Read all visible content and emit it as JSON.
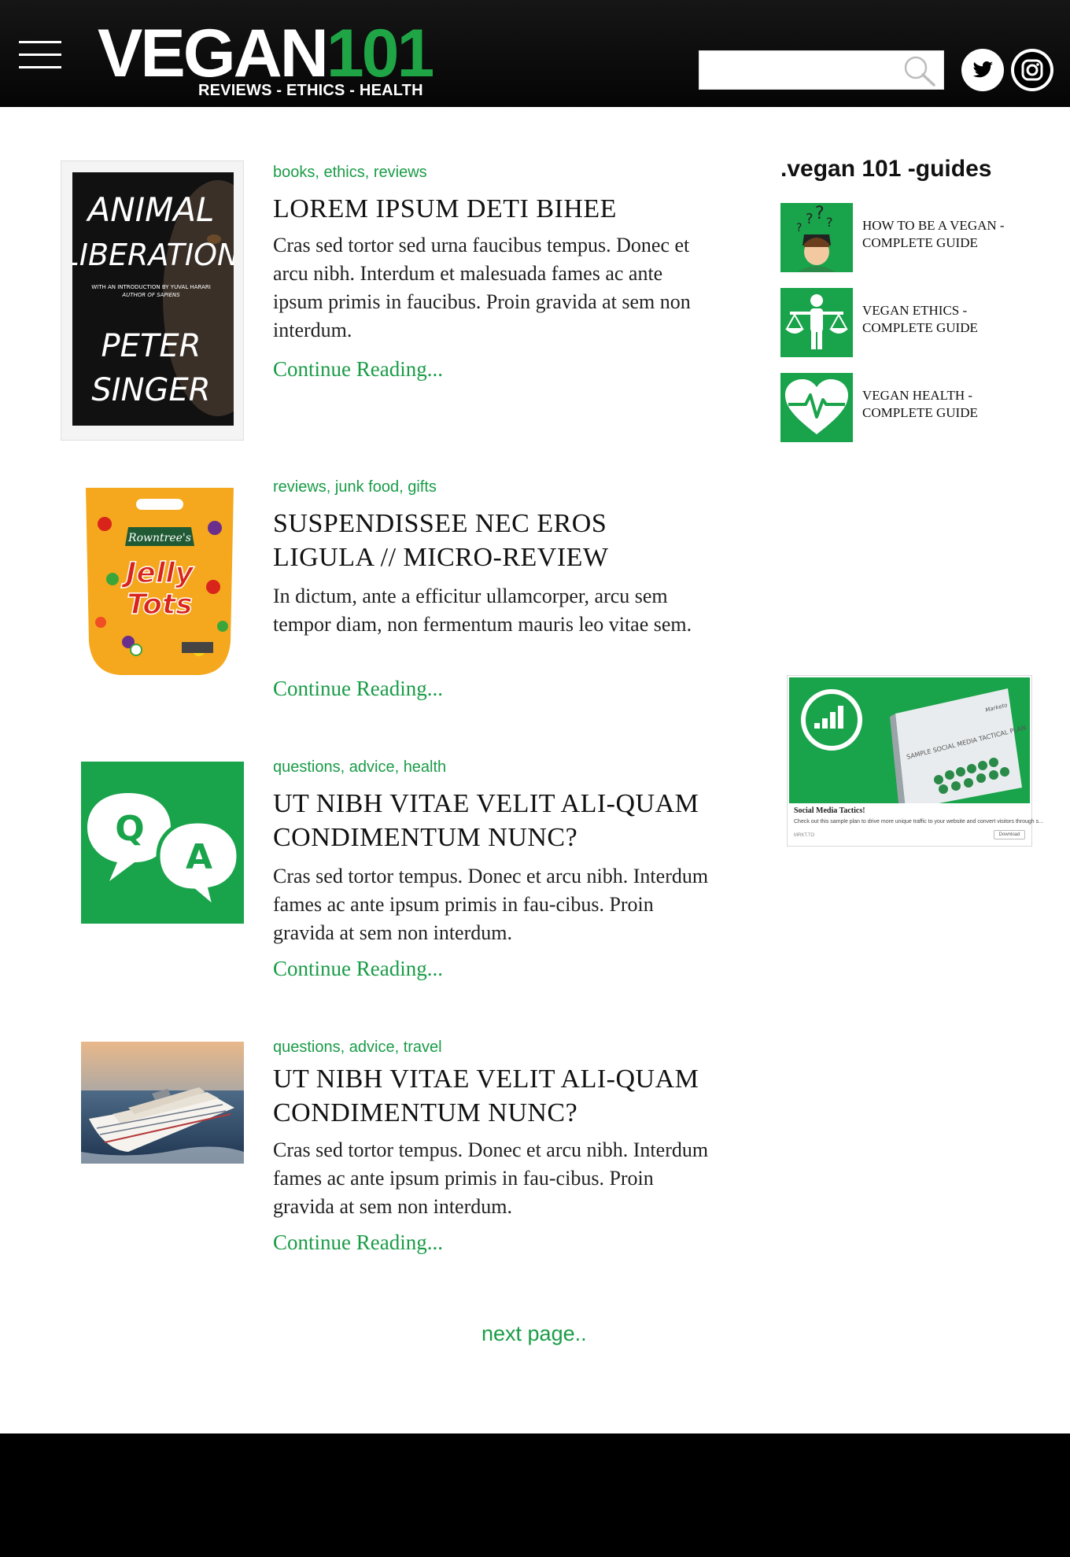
{
  "header": {
    "logo_main": "VEGAN",
    "logo_num": "101",
    "logo_tagline": "REVIEWS - ETHICS - HEALTH",
    "search_placeholder": "",
    "colors": {
      "background": "#0a0a0a",
      "accent": "#1fa546"
    }
  },
  "posts": [
    {
      "tags": [
        "books",
        "ethics",
        "reviews"
      ],
      "title": "LOREM IPSUM DETI BIHEE",
      "excerpt": "Cras sed tortor sed urna faucibus tempus. Donec et arcu nibh. Interdum et malesuada fames ac ante ipsum primis in faucibus. Proin gravida at sem non interdum.",
      "continue": "Continue Reading...",
      "thumb": {
        "type": "book-cover",
        "line1": "ANIMAL",
        "line2": "LIBERATION",
        "intro": "WITH AN INTRODUCTION BY YUVAL HARARI",
        "intro2": "AUTHOR OF SAPIENS",
        "author1": "PETER",
        "author2": "SINGER"
      }
    },
    {
      "tags": [
        "reviews",
        "junk food",
        "gifts"
      ],
      "title": "SUSPENDISSEE NEC EROS LIGULA // MICRO-REVIEW",
      "excerpt": "In dictum, ante a efficitur ullamcorper, arcu sem tempor diam, non fermentum mauris leo vitae sem.",
      "continue": "Continue Reading...",
      "thumb": {
        "type": "candy-bag",
        "brand": "Rowntree's",
        "product1": "Jelly",
        "product2": "Tots"
      }
    },
    {
      "tags": [
        "questions",
        "advice",
        "health"
      ],
      "title": "UT NIBH VITAE VELIT ALI-QUAM CONDIMENTUM NUNC?",
      "excerpt": "Cras sed tortor tempus. Donec et arcu nibh. Interdum fames ac ante ipsum primis in fau-cibus. Proin gravida at sem non interdum.",
      "continue": "Continue Reading...",
      "thumb": {
        "type": "qa-icon",
        "q": "Q",
        "a": "A"
      }
    },
    {
      "tags": [
        "questions",
        "advice",
        "travel"
      ],
      "title": "UT NIBH VITAE VELIT ALI-QUAM CONDIMENTUM NUNC?",
      "excerpt": "Cras sed tortor tempus. Donec et arcu nibh. Interdum fames ac ante ipsum primis in fau-cibus. Proin gravida at sem non interdum.",
      "continue": "Continue Reading...",
      "thumb": {
        "type": "cruise-ship-photo"
      }
    }
  ],
  "pagination": {
    "next_label": "next page.."
  },
  "sidebar": {
    "heading": ".vegan 101 -guides",
    "guides": [
      {
        "label": "HOW TO BE A VEGAN - COMPLETE GUIDE",
        "icon": "confused-person-icon"
      },
      {
        "label": "VEGAN ETHICS - COMPLETE GUIDE",
        "icon": "scales-person-icon"
      },
      {
        "label": "VEGAN HEALTH - COMPLETE GUIDE",
        "icon": "heartbeat-icon"
      }
    ],
    "ad": {
      "book_title": "SAMPLE SOCIAL MEDIA TACTICAL PLAN",
      "brand": "Marketo",
      "title": "Social Media Tactics!",
      "text": "Check out this sample plan to drive more unique traffic to your website and convert visitors through s...",
      "domain": "MRKT.TO",
      "button": "Download"
    }
  },
  "colors": {
    "accent_green": "#1a9c47",
    "footer": "#000000"
  }
}
